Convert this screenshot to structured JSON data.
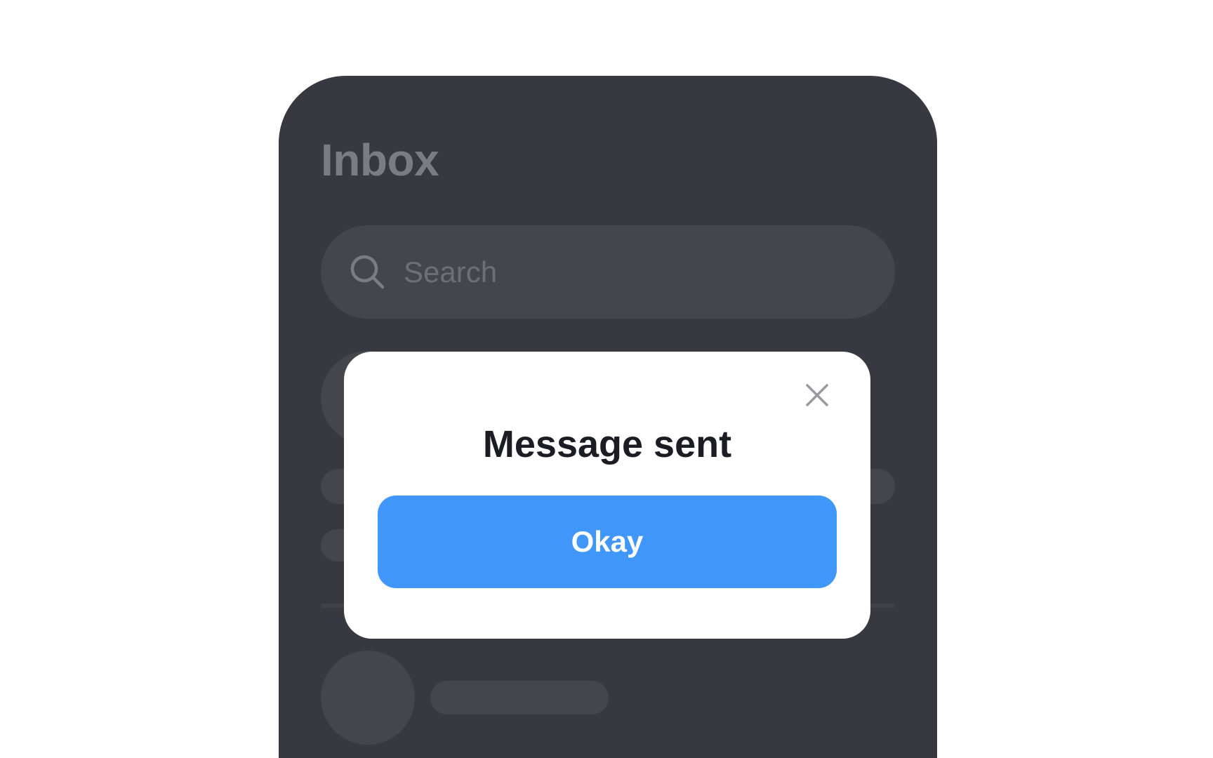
{
  "screen": {
    "title": "Inbox"
  },
  "search": {
    "placeholder": "Search"
  },
  "dialog": {
    "title": "Message sent",
    "confirm_label": "Okay"
  },
  "colors": {
    "background": "#ffffff",
    "phone_surface": "#383840",
    "skeleton": "#45454d",
    "title_muted": "#7b7b82",
    "dialog_surface": "#ffffff",
    "dialog_title": "#1c1c24",
    "primary_button": "#4096f9",
    "close_icon": "#9a9aa0"
  },
  "icons": {
    "search": "search-icon",
    "close": "close-icon"
  }
}
